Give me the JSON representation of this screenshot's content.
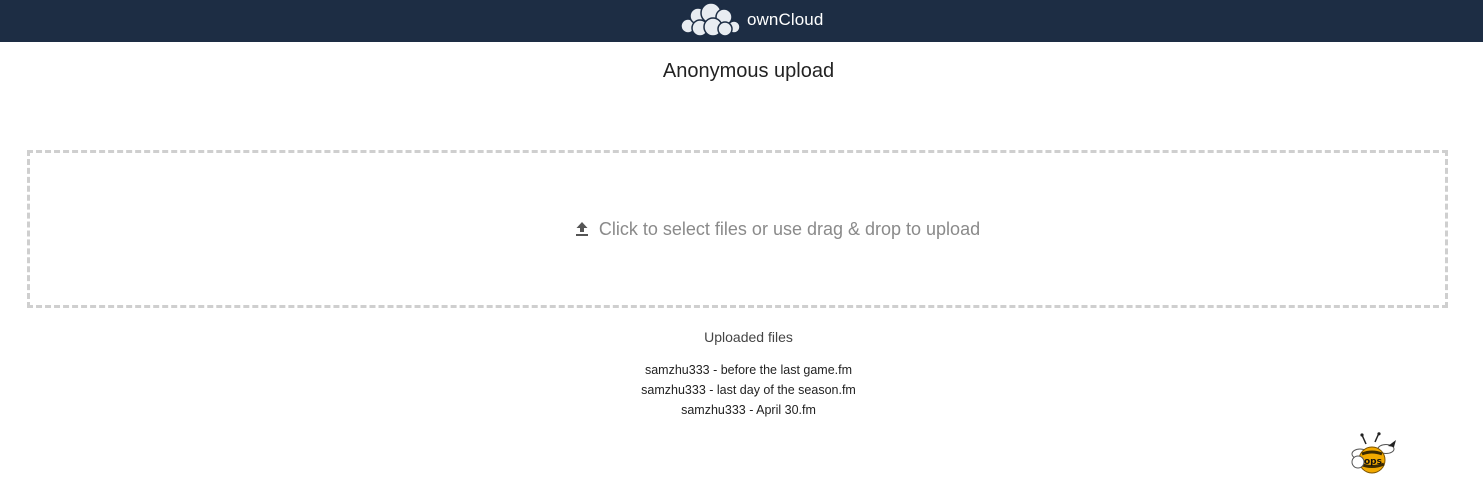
{
  "header": {
    "brand": "ownCloud",
    "logo_icon": "owncloud-cloud-logo",
    "background": "#1d2d44"
  },
  "page": {
    "title": "Anonymous upload"
  },
  "dropzone": {
    "icon": "upload-icon",
    "text": "Click to select files or use drag & drop to upload"
  },
  "uploaded": {
    "heading": "Uploaded files",
    "files": [
      "samzhu333 - before the last game.fm",
      "samzhu333 - last day of the season.fm",
      "samzhu333 - April 30.fm"
    ]
  },
  "mascot": {
    "icon": "mascot-bee-icon",
    "text": "ops"
  }
}
